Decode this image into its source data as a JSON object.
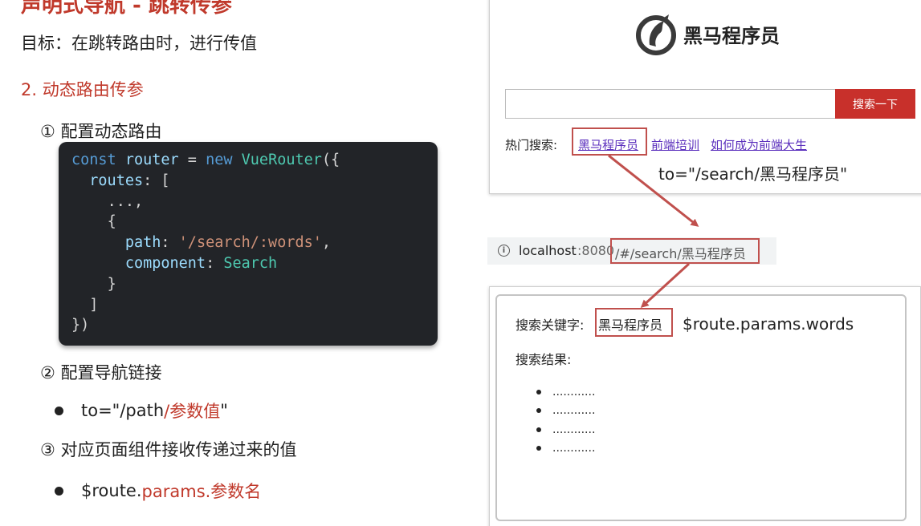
{
  "slide": {
    "title": "声明式导航 - 跳转传参",
    "goal": "目标：在跳转路由时，进行传值",
    "section": "2. 动态路由传参",
    "step1": "① 配置动态路由",
    "step2": "② 配置导航链接",
    "step3": "③ 对应页面组件接收传递过来的值",
    "bullet1": {
      "prefix": "to=\"/path",
      "highlight": "/参数值",
      "suffix": "\""
    },
    "bullet2": {
      "prefix": "$route.",
      "highlight": "params.参数名"
    }
  },
  "code": {
    "line1_kw1": "const",
    "line1_var": "router",
    "line1_eq": " = ",
    "line1_kw2": "new",
    "line1_fn": "VueRouter",
    "line1_end": "({",
    "line2_key": "routes",
    "line2_end": ": [",
    "line3": "...,",
    "line4": "{",
    "line5_key": "path",
    "line5_colon": ": ",
    "line5_str": "'/search/:words'",
    "line5_end": ",",
    "line6_key": "component",
    "line6_colon": ": ",
    "line6_val": "Search",
    "line7": "}",
    "line8": "]",
    "line9": "})"
  },
  "browser_top": {
    "logo_text": "黑马程序员",
    "search_button": "搜索一下",
    "hot_label": "热门搜索:",
    "hot_links": [
      "黑马程序员",
      "前端培训",
      "如何成为前端大生"
    ],
    "to_annotation": "to=\"/search/黑马程序员\""
  },
  "url_bar": {
    "host": "localhost",
    "port": ":8080",
    "path": "/#/search/黑马程序员"
  },
  "result_page": {
    "keyword_label": "搜索关键字:",
    "keyword_value": "黑马程序员",
    "params_annotation": "$route.params.words",
    "results_label": "搜索结果:",
    "results": [
      "............",
      "............",
      "............",
      "............"
    ]
  },
  "colors": {
    "accent_red": "#c0392b",
    "button_red": "#c8302b",
    "link_purple": "#5b2fbd",
    "code_bg": "#222428"
  }
}
